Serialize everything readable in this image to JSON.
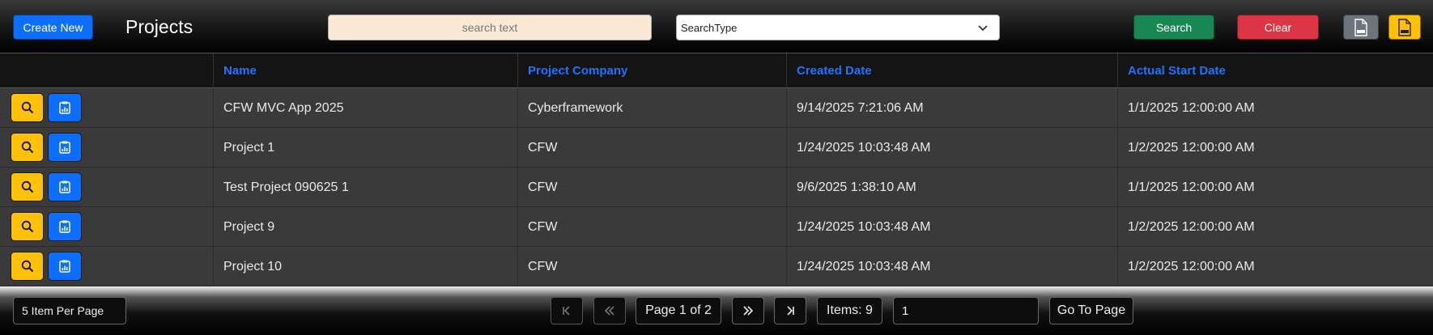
{
  "toolbar": {
    "create_label": "Create New",
    "title": "Projects",
    "search_placeholder": "search text",
    "search_type": "SearchType",
    "search_label": "Search",
    "clear_label": "Clear",
    "csv_icon": "csv-file-icon",
    "pdf_icon": "pdf-file-icon"
  },
  "table": {
    "headers": [
      "Name",
      "Project Company",
      "Created Date",
      "Actual Start Date"
    ],
    "rows": [
      {
        "name": "CFW MVC App 2025",
        "company": "Cyberframework",
        "created": "9/14/2025 7:21:06 AM",
        "start": "1/1/2025 12:00:00 AM"
      },
      {
        "name": "Project 1",
        "company": "CFW",
        "created": "1/24/2025 10:03:48 AM",
        "start": "1/2/2025 12:00:00 AM"
      },
      {
        "name": "Test Project 090625 1",
        "company": "CFW",
        "created": "9/6/2025 1:38:10 AM",
        "start": "1/1/2025 12:00:00 AM"
      },
      {
        "name": "Project 9",
        "company": "CFW",
        "created": "1/24/2025 10:03:48 AM",
        "start": "1/2/2025 12:00:00 AM"
      },
      {
        "name": "Project 10",
        "company": "CFW",
        "created": "1/24/2025 10:03:48 AM",
        "start": "1/2/2025 12:00:00 AM"
      }
    ]
  },
  "pager": {
    "per_page": "5 Item Per Page",
    "page_info": "Page 1 of 2",
    "items": "Items: 9",
    "page_value": "1",
    "goto_label": "Go To Page"
  },
  "colors": {
    "primary": "#0d6efd",
    "success": "#198754",
    "danger": "#dc3545",
    "warning": "#ffc107",
    "secondary": "#6c757d",
    "header_text": "#1e74ff"
  }
}
